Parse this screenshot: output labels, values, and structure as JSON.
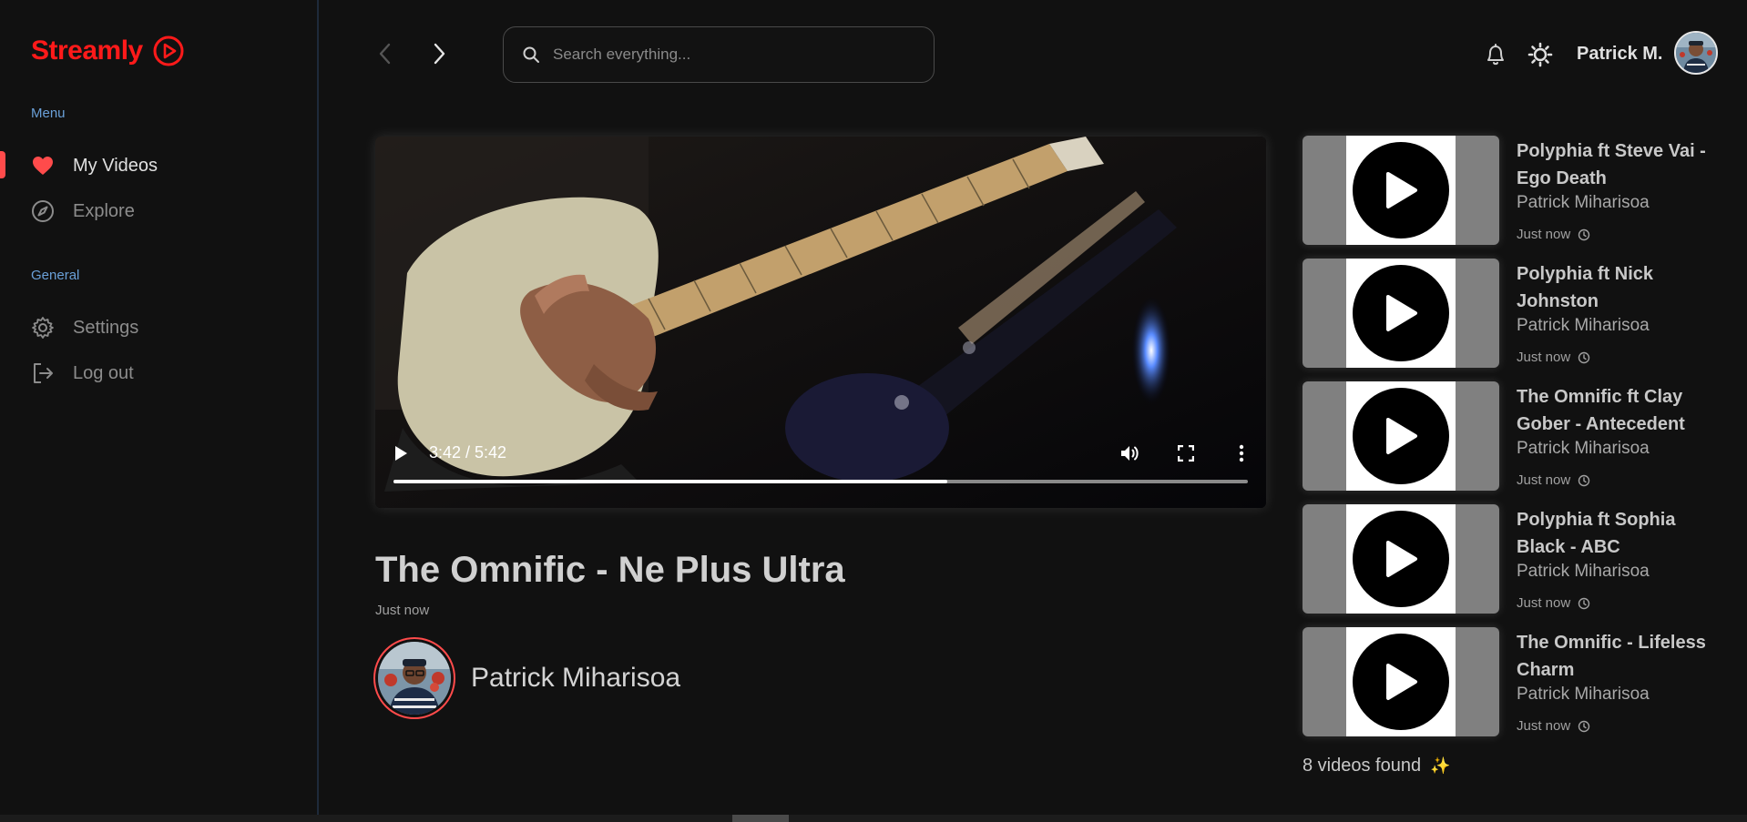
{
  "app": {
    "name": "Streamly",
    "brand_color": "#ff1a1a",
    "accent_color": "#ff4b4b"
  },
  "sidebar": {
    "sections": [
      {
        "label": "Menu",
        "items": [
          {
            "label": "My Videos",
            "icon": "heart-icon",
            "active": true
          },
          {
            "label": "Explore",
            "icon": "compass-icon",
            "active": false
          }
        ]
      },
      {
        "label": "General",
        "items": [
          {
            "label": "Settings",
            "icon": "gear-icon",
            "active": false
          },
          {
            "label": "Log out",
            "icon": "logout-icon",
            "active": false
          }
        ]
      }
    ]
  },
  "header": {
    "search_placeholder": "Search everything...",
    "user_name": "Patrick M."
  },
  "player": {
    "time_display": "3:42 / 5:42",
    "progress": 0.6487
  },
  "video": {
    "title": "The Omnific - Ne Plus Ultra",
    "time": "Just now",
    "author": "Patrick Miharisoa"
  },
  "related": [
    {
      "title": "Polyphia ft Steve Vai - Ego Death",
      "author": "Patrick Miharisoa",
      "time": "Just now"
    },
    {
      "title": "Polyphia ft Nick Johnston",
      "author": "Patrick Miharisoa",
      "time": "Just now"
    },
    {
      "title": "The Omnific ft Clay Gober - Antecedent",
      "author": "Patrick Miharisoa",
      "time": "Just now"
    },
    {
      "title": "Polyphia ft Sophia Black - ABC",
      "author": "Patrick Miharisoa",
      "time": "Just now"
    },
    {
      "title": "The Omnific - Lifeless Charm",
      "author": "Patrick Miharisoa",
      "time": "Just now"
    }
  ],
  "footer": {
    "videos_found": "8 videos found",
    "sparkle": "✨"
  }
}
